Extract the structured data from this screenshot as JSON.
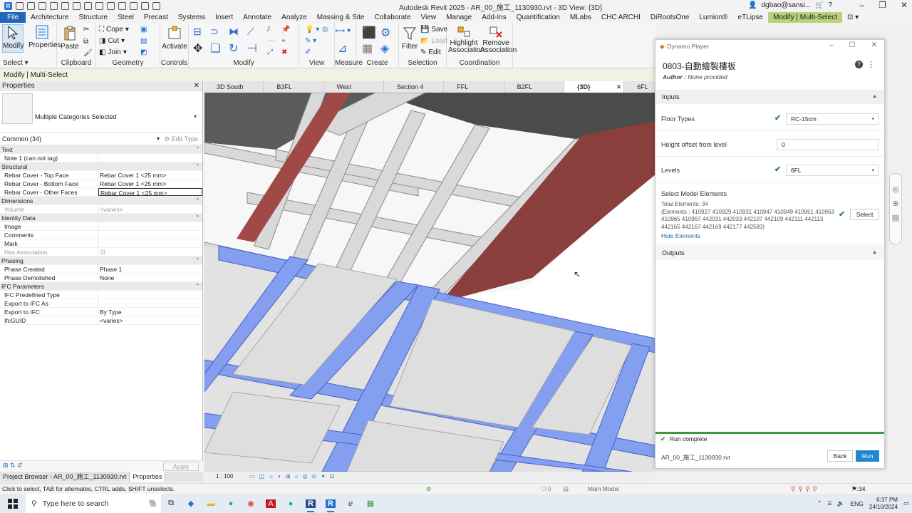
{
  "window": {
    "title": "Autodesk Revit 2025 - AR_00_施工_1130930.rvt - 3D View: {3D}",
    "user": "dgbao@sansi..."
  },
  "menu_tabs": [
    {
      "label": "File"
    },
    {
      "label": "Architecture"
    },
    {
      "label": "Structure"
    },
    {
      "label": "Steel"
    },
    {
      "label": "Precast"
    },
    {
      "label": "Systems"
    },
    {
      "label": "Insert"
    },
    {
      "label": "Annotate"
    },
    {
      "label": "Analyze"
    },
    {
      "label": "Massing & Site"
    },
    {
      "label": "Collaborate"
    },
    {
      "label": "View"
    },
    {
      "label": "Manage"
    },
    {
      "label": "Add-Ins"
    },
    {
      "label": "Quantification"
    },
    {
      "label": "MLabs"
    },
    {
      "label": "CHC ARCHI"
    },
    {
      "label": "DiRootsOne"
    },
    {
      "label": "Lumion®"
    },
    {
      "label": "eTLipse"
    },
    {
      "label": "Modify | Multi-Select"
    }
  ],
  "ribbon": {
    "modify": "Modify",
    "select": "Select",
    "properties": "Properties",
    "paste": "Paste",
    "clipboard": "Clipboard",
    "cope": "Cope",
    "cut": "Cut",
    "join": "Join",
    "geometry": "Geometry",
    "activate": "Activate",
    "controls": "Controls",
    "modify_panel": "Modify",
    "view": "View",
    "measure": "Measure",
    "create": "Create",
    "filter": "Filter",
    "save": "Save",
    "load": "Load",
    "edit": "Edit",
    "selection": "Selection",
    "highlight_association": "Highlight Association",
    "remove_association": "Remove Association",
    "coordination": "Coordination"
  },
  "context_bar": "Modify | Multi-Select",
  "properties": {
    "title": "Properties",
    "type_name": "Multiple Categories Selected",
    "instance_filter": "Common (34)",
    "edit_type": "Edit Type",
    "rows": [
      {
        "name": "Text",
        "value": "",
        "group": true
      },
      {
        "name": "Note 1 (can not tag)",
        "value": ""
      },
      {
        "name": "Structural",
        "value": "",
        "group": true
      },
      {
        "name": "Rebar Cover - Top Face",
        "value": "Rebar Cover 1 <25 mm>"
      },
      {
        "name": "Rebar Cover - Bottom Face",
        "value": "Rebar Cover 1 <25 mm>"
      },
      {
        "name": "Rebar Cover - Other Faces",
        "value": "Rebar Cover 1 <25 mm>",
        "box": true
      },
      {
        "name": "Dimensions",
        "value": "",
        "group": true
      },
      {
        "name": "Volume",
        "value": "<varies>",
        "dim": true
      },
      {
        "name": "Identity Data",
        "value": "",
        "group": true
      },
      {
        "name": "Image",
        "value": ""
      },
      {
        "name": "Comments",
        "value": ""
      },
      {
        "name": "Mark",
        "value": ""
      },
      {
        "name": "Has Association",
        "value": "☑",
        "dim": true
      },
      {
        "name": "Phasing",
        "value": "",
        "group": true
      },
      {
        "name": "Phase Created",
        "value": "Phase 1"
      },
      {
        "name": "Phase Demolished",
        "value": "None"
      },
      {
        "name": "IFC Parameters",
        "value": "",
        "group": true
      },
      {
        "name": "IFC Predefined Type",
        "value": ""
      },
      {
        "name": "Export to IFC As",
        "value": ""
      },
      {
        "name": "Export to IFC",
        "value": "By Type"
      },
      {
        "name": "IfcGUID",
        "value": "<varies>"
      }
    ],
    "apply": "Apply",
    "browser_tab": "Project Browser - AR_00_施工_1130930.rvt",
    "properties_tab": "Properties"
  },
  "view_tabs": [
    {
      "label": "3D South"
    },
    {
      "label": "B3FL"
    },
    {
      "label": "West"
    },
    {
      "label": "Section 4"
    },
    {
      "label": "FFL"
    },
    {
      "label": "B2FL"
    },
    {
      "label": "{3D}",
      "active": true
    },
    {
      "label": "6FL"
    }
  ],
  "view_scale": "1 : 100",
  "dynamo": {
    "window_title": "Dynamo Player",
    "script_name": "0803-自動繪製樓板",
    "author_label": "Author :",
    "author_value": "None provided",
    "inputs_label": "Inputs",
    "floor_types_label": "Floor Types",
    "floor_types_value": "RC-15cm",
    "height_offset_label": "Height offset from level",
    "height_offset_value": "0",
    "levels_label": "Levels",
    "levels_value": "6FL",
    "select_label": "Select Model Elements",
    "total_label": "Total Elements: 34",
    "elements_text": "(Elements : 410927 410929 410931 410947 410949 410951 410963 410965 410967 442031 442033 442107 442109 442111 442113 442165 442167 442169 442177 442583)",
    "select_button": "Select",
    "hide_elements": "Hide Elements",
    "outputs_label": "Outputs",
    "status": "Run complete",
    "file_name": "AR_00_施工_1130930.rvt",
    "back_button": "Back",
    "run_button": "Run"
  },
  "status_bar": {
    "hint": "Click to select, TAB for alternates, CTRL adds, SHIFT unselects.",
    "zero": ":0",
    "model": "Main Model",
    "count": ":34"
  },
  "taskbar": {
    "search_placeholder": "Type here to search",
    "lang": "ENG",
    "time": "6:37 PM",
    "date": "24/10/2024"
  },
  "colors": {
    "accent": "#1e88d0",
    "context_tab": "#b9d27b",
    "file_tab": "#2266b8",
    "run_ok": "#3c9a3c",
    "selected_blue": "#7f9cf0",
    "wall_red": "#8b3f3d"
  }
}
